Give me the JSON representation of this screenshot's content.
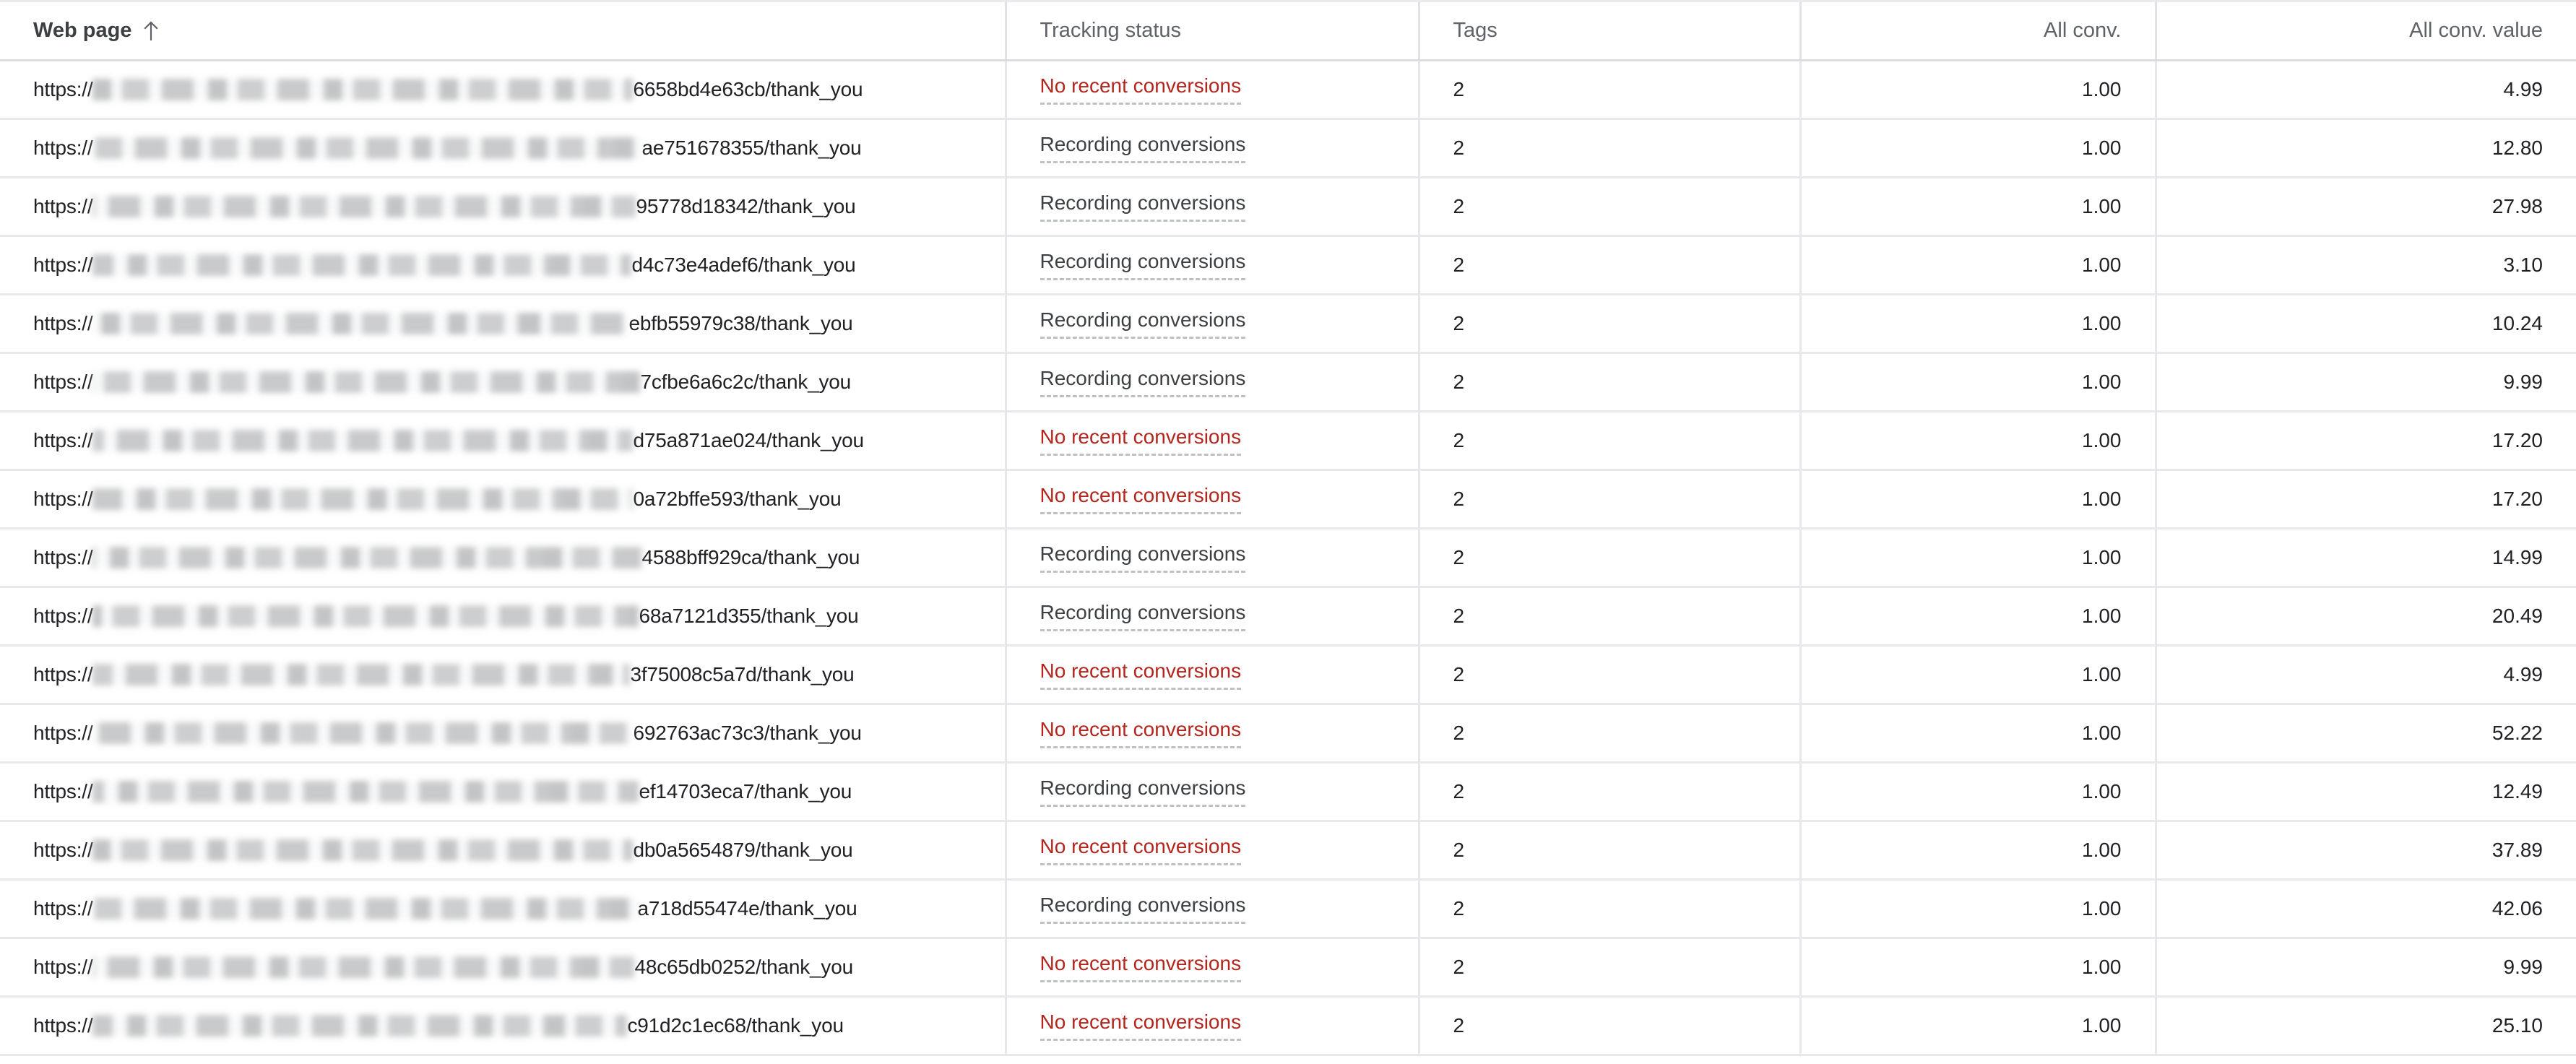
{
  "table": {
    "columns": [
      {
        "key": "web_page",
        "label": "Web page",
        "align": "left",
        "sorted": true,
        "sort_direction": "ascending",
        "sort_icon": "arrow-up-icon"
      },
      {
        "key": "tracking_status",
        "label": "Tracking status",
        "align": "left",
        "sorted": false
      },
      {
        "key": "tags",
        "label": "Tags",
        "align": "left",
        "sorted": false
      },
      {
        "key": "all_conv",
        "label": "All conv.",
        "align": "right",
        "sorted": false
      },
      {
        "key": "all_conv_value",
        "label": "All conv. value",
        "align": "right",
        "sorted": false
      }
    ],
    "status_labels": {
      "recording": "Recording conversions",
      "none": "No recent conversions"
    },
    "colors": {
      "status_none": "#b3261e",
      "status_recording": "#3c4043",
      "header_text": "#3c4043",
      "body_text": "#202124",
      "row_divider": "#e6e8eb",
      "header_divider": "#dadce0"
    },
    "url_prefix": "https://",
    "rows": [
      {
        "url_suffix": "6658bd4e63cb/thank_you",
        "redacted_width": 748,
        "tracking_status": "No recent conversions",
        "status_kind": "none",
        "tags": "2",
        "all_conv": "1.00",
        "all_conv_value": "4.99"
      },
      {
        "url_suffix": "ae751678355/thank_you",
        "redacted_width": 760,
        "tracking_status": "Recording conversions",
        "status_kind": "recording",
        "tags": "2",
        "all_conv": "1.00",
        "all_conv_value": "12.80"
      },
      {
        "url_suffix": "95778d18342/thank_you",
        "redacted_width": 752,
        "tracking_status": "Recording conversions",
        "status_kind": "recording",
        "tags": "2",
        "all_conv": "1.00",
        "all_conv_value": "27.98"
      },
      {
        "url_suffix": "d4c73e4adef6/thank_you",
        "redacted_width": 746,
        "tracking_status": "Recording conversions",
        "status_kind": "recording",
        "tags": "2",
        "all_conv": "1.00",
        "all_conv_value": "3.10"
      },
      {
        "url_suffix": "ebfb55979c38/thank_you",
        "redacted_width": 742,
        "tracking_status": "Recording conversions",
        "status_kind": "recording",
        "tags": "2",
        "all_conv": "1.00",
        "all_conv_value": "10.24"
      },
      {
        "url_suffix": "7cfbe6a6c2c/thank_you",
        "redacted_width": 758,
        "tracking_status": "Recording conversions",
        "status_kind": "recording",
        "tags": "2",
        "all_conv": "1.00",
        "all_conv_value": "9.99"
      },
      {
        "url_suffix": "d75a871ae024/thank_you",
        "redacted_width": 748,
        "tracking_status": "No recent conversions",
        "status_kind": "none",
        "tags": "2",
        "all_conv": "1.00",
        "all_conv_value": "17.20"
      },
      {
        "url_suffix": "0a72bffe593/thank_you",
        "redacted_width": 748,
        "tracking_status": "No recent conversions",
        "status_kind": "none",
        "tags": "2",
        "all_conv": "1.00",
        "all_conv_value": "17.20"
      },
      {
        "url_suffix": "4588bff929ca/thank_you",
        "redacted_width": 760,
        "tracking_status": "Recording conversions",
        "status_kind": "recording",
        "tags": "2",
        "all_conv": "1.00",
        "all_conv_value": "14.99"
      },
      {
        "url_suffix": "68a7121d355/thank_you",
        "redacted_width": 756,
        "tracking_status": "Recording conversions",
        "status_kind": "recording",
        "tags": "2",
        "all_conv": "1.00",
        "all_conv_value": "20.49"
      },
      {
        "url_suffix": "3f75008c5a7d/thank_you",
        "redacted_width": 744,
        "tracking_status": "No recent conversions",
        "status_kind": "none",
        "tags": "2",
        "all_conv": "1.00",
        "all_conv_value": "4.99"
      },
      {
        "url_suffix": "692763ac73c3/thank_you",
        "redacted_width": 748,
        "tracking_status": "No recent conversions",
        "status_kind": "none",
        "tags": "2",
        "all_conv": "1.00",
        "all_conv_value": "52.22"
      },
      {
        "url_suffix": "ef14703eca7/thank_you",
        "redacted_width": 756,
        "tracking_status": "Recording conversions",
        "status_kind": "recording",
        "tags": "2",
        "all_conv": "1.00",
        "all_conv_value": "12.49"
      },
      {
        "url_suffix": "db0a5654879/thank_you",
        "redacted_width": 748,
        "tracking_status": "No recent conversions",
        "status_kind": "none",
        "tags": "2",
        "all_conv": "1.00",
        "all_conv_value": "37.89"
      },
      {
        "url_suffix": "a718d55474e/thank_you",
        "redacted_width": 754,
        "tracking_status": "Recording conversions",
        "status_kind": "recording",
        "tags": "2",
        "all_conv": "1.00",
        "all_conv_value": "42.06"
      },
      {
        "url_suffix": "48c65db0252/thank_you",
        "redacted_width": 750,
        "tracking_status": "No recent conversions",
        "status_kind": "none",
        "tags": "2",
        "all_conv": "1.00",
        "all_conv_value": "9.99"
      },
      {
        "url_suffix": "c91d2c1ec68/thank_you",
        "redacted_width": 740,
        "tracking_status": "No recent conversions",
        "status_kind": "none",
        "tags": "2",
        "all_conv": "1.00",
        "all_conv_value": "25.10"
      }
    ]
  }
}
